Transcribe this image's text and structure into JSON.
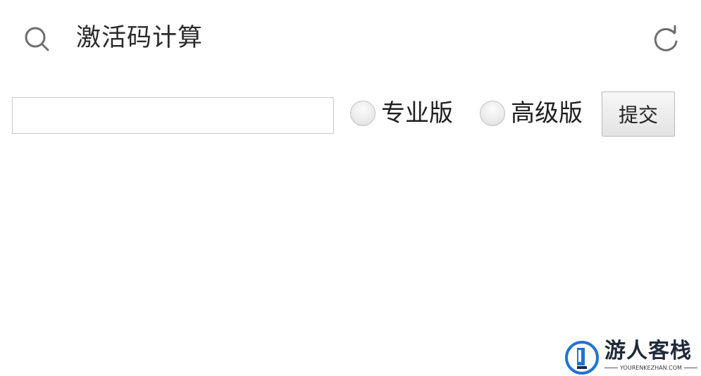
{
  "header": {
    "title": "激活码计算",
    "search_icon": "search-icon",
    "refresh_icon": "refresh-icon"
  },
  "form": {
    "code_input": {
      "value": "",
      "placeholder": ""
    },
    "options": [
      {
        "label": "专业版",
        "selected": false
      },
      {
        "label": "高级版",
        "selected": false
      }
    ],
    "submit_label": "提交"
  },
  "watermark": {
    "name": "游人客栈",
    "domain": "YOURENKEZHAN.COM",
    "colors": {
      "blue": "#1e73d8",
      "dark": "#202a3a"
    }
  },
  "colors": {
    "background": "#ffffff",
    "icon_gray": "#6e6e6e",
    "text": "#222222",
    "input_border": "#c9c9c9"
  }
}
